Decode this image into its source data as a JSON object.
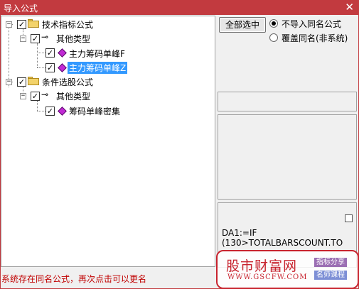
{
  "window": {
    "title": "导入公式",
    "close_glyph": "✕"
  },
  "tree": {
    "nodes": [
      {
        "label": "技术指标公式",
        "checked": true,
        "icon": "folder-icon"
      },
      {
        "label": "其他类型",
        "checked": true,
        "icon": "key-icon"
      },
      {
        "label": "主力筹码单峰F",
        "checked": true,
        "icon": "gem-icon"
      },
      {
        "label": "主力筹码单峰Z",
        "checked": true,
        "icon": "gem-icon",
        "selected": true
      },
      {
        "label": "条件选股公式",
        "checked": true,
        "icon": "folder-icon"
      },
      {
        "label": "其他类型",
        "checked": true,
        "icon": "key-icon"
      },
      {
        "label": "筹码单峰密集",
        "checked": true,
        "icon": "gem-icon"
      }
    ],
    "expander_glyph": "−",
    "check_glyph": "✓",
    "key_glyph": "⊸"
  },
  "controls": {
    "select_all_label": "全部选中",
    "radio_options": [
      {
        "label": "不导入同名公式",
        "selected": true
      },
      {
        "label": "覆盖同名(非系统)",
        "selected": false
      }
    ]
  },
  "code_preview": {
    "line1": "DA1:=IF",
    "line2": "(130>TOTALBARSCOUNT.TO"
  },
  "status_message": "系统存在同名公式，再次点击可以更名",
  "watermark": {
    "name": "股市财富网",
    "url": "WWW.GSCFW.COM",
    "tag1": "指标分享",
    "tag2": "名师课程",
    "color": "#c8242f"
  }
}
